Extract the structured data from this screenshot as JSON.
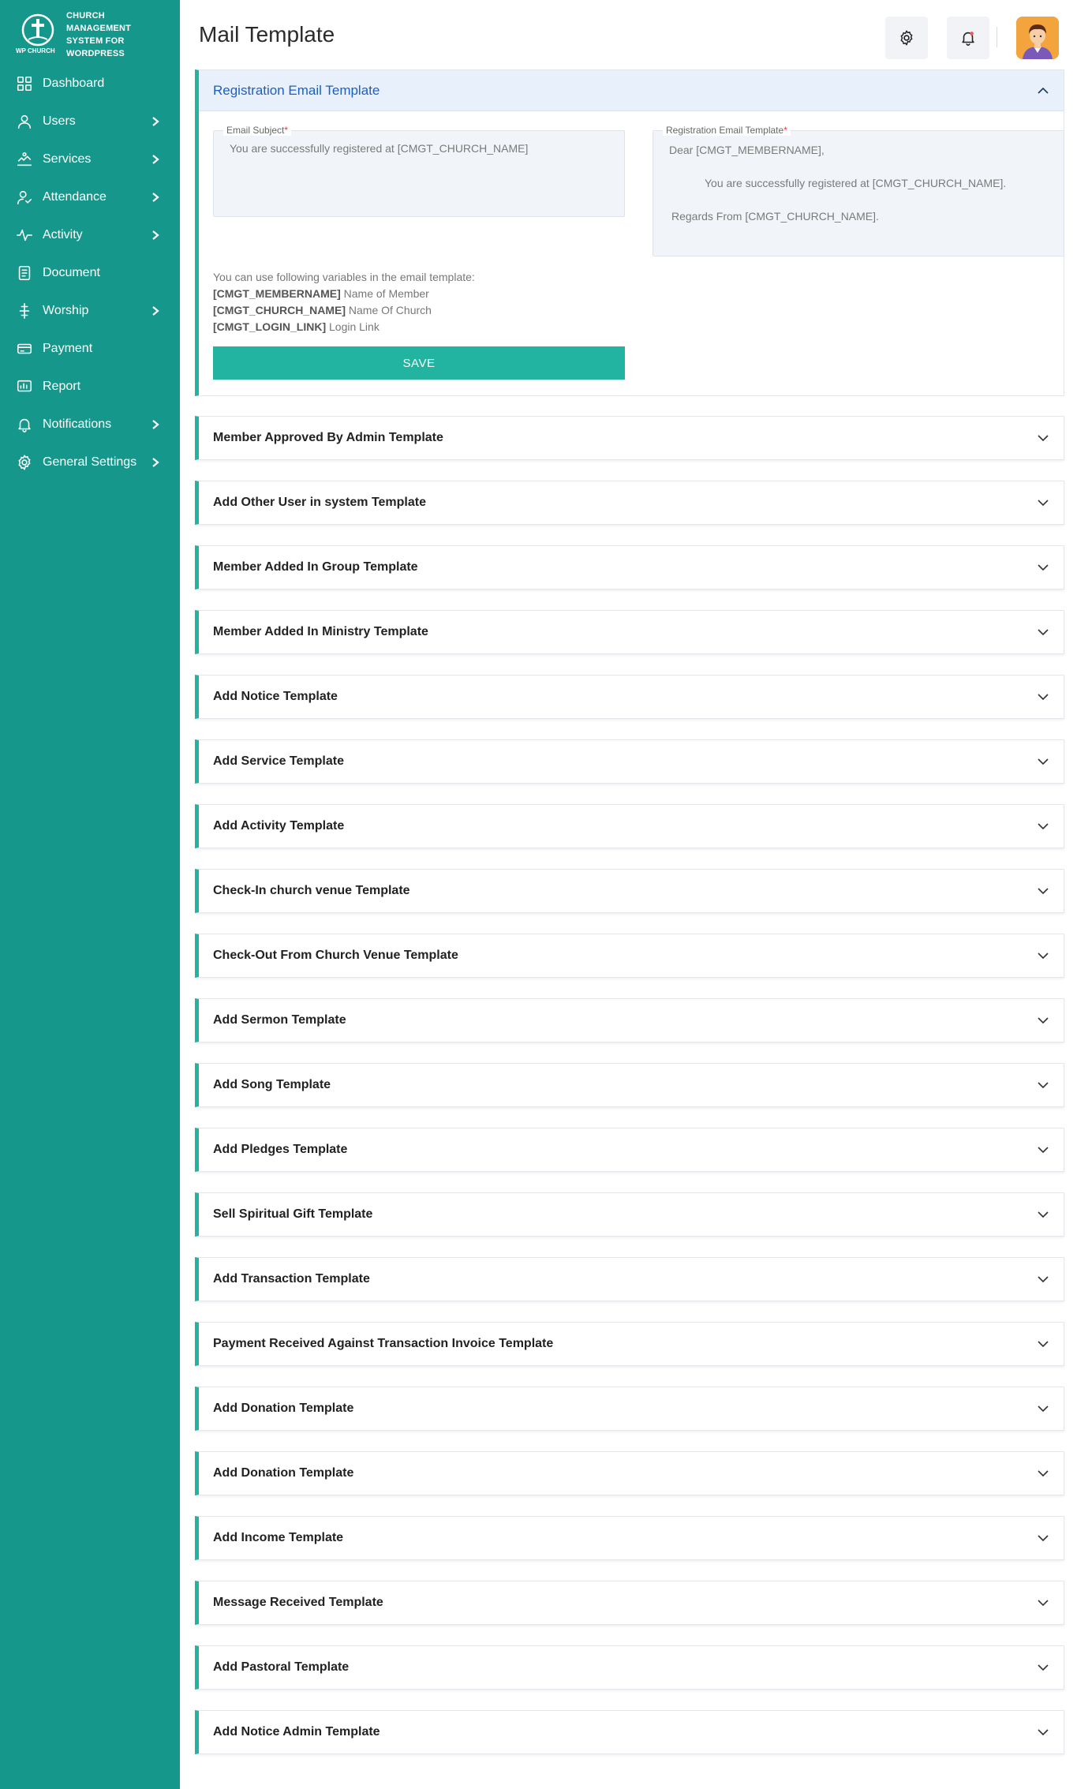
{
  "brand": {
    "logo_text": "WP CHURCH",
    "line1": "Church Management",
    "line2": "System for",
    "line3": "WordPress"
  },
  "sidebar": {
    "items": [
      {
        "label": "Dashboard",
        "icon": "dashboard-icon",
        "has_children": false
      },
      {
        "label": "Users",
        "icon": "user-icon",
        "has_children": true
      },
      {
        "label": "Services",
        "icon": "services-icon",
        "has_children": true
      },
      {
        "label": "Attendance",
        "icon": "attendance-icon",
        "has_children": true
      },
      {
        "label": "Activity",
        "icon": "activity-icon",
        "has_children": true
      },
      {
        "label": "Document",
        "icon": "document-icon",
        "has_children": false
      },
      {
        "label": "Worship",
        "icon": "worship-icon",
        "has_children": true
      },
      {
        "label": "Payment",
        "icon": "payment-icon",
        "has_children": false
      },
      {
        "label": "Report",
        "icon": "report-icon",
        "has_children": false
      },
      {
        "label": "Notifications",
        "icon": "bell-icon",
        "has_children": true
      },
      {
        "label": "General Settings",
        "icon": "gear-icon",
        "has_children": true
      }
    ]
  },
  "header": {
    "title": "Mail Template"
  },
  "open_template": {
    "title": "Registration Email Template",
    "subject_label": "Email Subject",
    "subject_value": "You are successfully registered at [CMGT_CHURCH_NAME]",
    "body_label": "Registration Email Template",
    "body_line1": "Dear [CMGT_MEMBERNAME],",
    "body_line2": "You are successfully registered at [CMGT_CHURCH_NAME].",
    "body_line3": "Regards From [CMGT_CHURCH_NAME].",
    "vars_intro": "You can use following variables in the email template:",
    "vars": [
      {
        "key": "[CMGT_MEMBERNAME]",
        "desc": "Name of Member"
      },
      {
        "key": "[CMGT_CHURCH_NAME]",
        "desc": "Name Of Church"
      },
      {
        "key": "[CMGT_LOGIN_LINK]",
        "desc": "Login Link"
      }
    ],
    "save_label": "SAVE"
  },
  "templates": [
    "Member Approved By Admin Template",
    "Add Other User in system Template",
    "Member Added In Group Template",
    "Member Added In Ministry Template",
    "Add Notice Template",
    "Add Service Template",
    "Add Activity Template",
    "Check-In church venue Template",
    "Check-Out From Church Venue Template",
    "Add Sermon Template",
    "Add Song Template",
    "Add Pledges Template",
    "Sell Spiritual Gift Template",
    "Add Transaction Template",
    "Payment Received Against Transaction Invoice Template",
    "Add Donation Template",
    "Add Donation Template",
    "Add Income Template",
    "Message Received Template",
    "Add Pastoral Template",
    "Add Notice Admin Template"
  ],
  "colors": {
    "sidebar": "#16978c",
    "accent": "#22b4a0",
    "open_head": "#e8f1fb",
    "open_title": "#1b5fc5"
  }
}
